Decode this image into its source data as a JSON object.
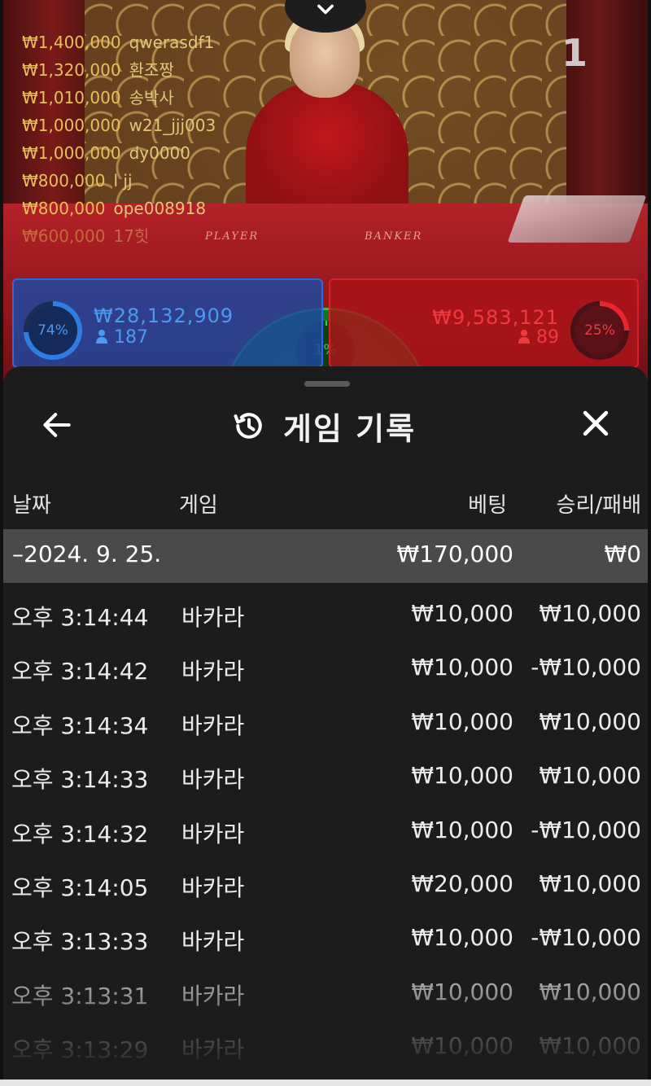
{
  "stream": {
    "round_number": "1",
    "table_labels": {
      "player": "PLAYER",
      "banker": "BANKER"
    },
    "winners": [
      {
        "amount": "₩1,400,000",
        "name": "qwerasdf1"
      },
      {
        "amount": "₩1,320,000",
        "name": "환조짱"
      },
      {
        "amount": "₩1,010,000",
        "name": "송박사"
      },
      {
        "amount": "₩1,000,000",
        "name": "w21_jjj003"
      },
      {
        "amount": "₩1,000,000",
        "name": "dy0000"
      },
      {
        "amount": "₩800,000",
        "name": "l jj"
      },
      {
        "amount": "₩800,000",
        "name": "ope008918"
      },
      {
        "amount": "₩600,000",
        "name": "17힛"
      }
    ]
  },
  "bets": {
    "player": {
      "percent": "74%",
      "percent_value": 74,
      "total": "₩28,132,909",
      "count": "187",
      "color": "#2f7de3"
    },
    "tie": {
      "percent": "1%",
      "percent_value": 1,
      "color": "#34d058"
    },
    "banker": {
      "percent": "25%",
      "percent_value": 25,
      "total": "₩9,583,121",
      "count": "89",
      "color": "#e8262e"
    }
  },
  "sheet": {
    "title": "게임 기록",
    "columns": {
      "date": "날짜",
      "game": "게임",
      "bet": "베팅",
      "win_loss": "승리/패배"
    },
    "date_group": {
      "date": "–2024. 9. 25.",
      "bet": "₩170,000",
      "win_loss": "₩0"
    },
    "rows": [
      {
        "time": "오후 3:14:44",
        "game": "바카라",
        "bet": "₩10,000",
        "win_loss": "₩10,000"
      },
      {
        "time": "오후 3:14:42",
        "game": "바카라",
        "bet": "₩10,000",
        "win_loss": "-₩10,000"
      },
      {
        "time": "오후 3:14:34",
        "game": "바카라",
        "bet": "₩10,000",
        "win_loss": "₩10,000"
      },
      {
        "time": "오후 3:14:33",
        "game": "바카라",
        "bet": "₩10,000",
        "win_loss": "₩10,000"
      },
      {
        "time": "오후 3:14:32",
        "game": "바카라",
        "bet": "₩10,000",
        "win_loss": "-₩10,000"
      },
      {
        "time": "오후 3:14:05",
        "game": "바카라",
        "bet": "₩20,000",
        "win_loss": "₩10,000"
      },
      {
        "time": "오후 3:13:33",
        "game": "바카라",
        "bet": "₩10,000",
        "win_loss": "-₩10,000"
      },
      {
        "time": "오후 3:13:31",
        "game": "바카라",
        "bet": "₩10,000",
        "win_loss": "₩10,000"
      },
      {
        "time": "오후 3:13:29",
        "game": "바카라",
        "bet": "₩10,000",
        "win_loss": "₩10,000"
      }
    ]
  },
  "icons": {
    "collapse": "chevron-down-icon",
    "back": "arrow-left-icon",
    "history": "history-icon",
    "close": "close-icon",
    "user": "user-icon"
  }
}
